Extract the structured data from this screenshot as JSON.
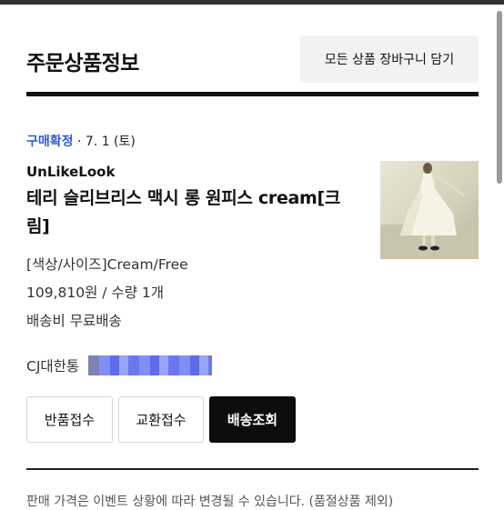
{
  "section": {
    "title": "주문상품정보",
    "add_all_label": "모든 상품 장바구니 담기"
  },
  "order": {
    "status": "구매확정",
    "date": "· 7. 1 (토)",
    "brand": "UnLikeLook",
    "product_name": "테리 슬리브리스 맥시 롱 원피스 cream[크림]",
    "option": "[색상/사이즈]Cream/Free",
    "price_qty": "109,810원 / 수량 1개",
    "shipping": "배송비 무료배송",
    "carrier": "CJ대한통",
    "thumbnail_icon": "product-photo-dress"
  },
  "actions": {
    "return_label": "반품접수",
    "exchange_label": "교환접수",
    "track_label": "배송조회"
  },
  "footer": {
    "notice": "판매 가격은 이벤트 상황에 따라 변경될 수 있습니다. (품절상품 제외)"
  },
  "colors": {
    "status": "#2f5bd3",
    "primary_button": "#0d0d0d",
    "secondary_button": "#f2f2f2"
  }
}
